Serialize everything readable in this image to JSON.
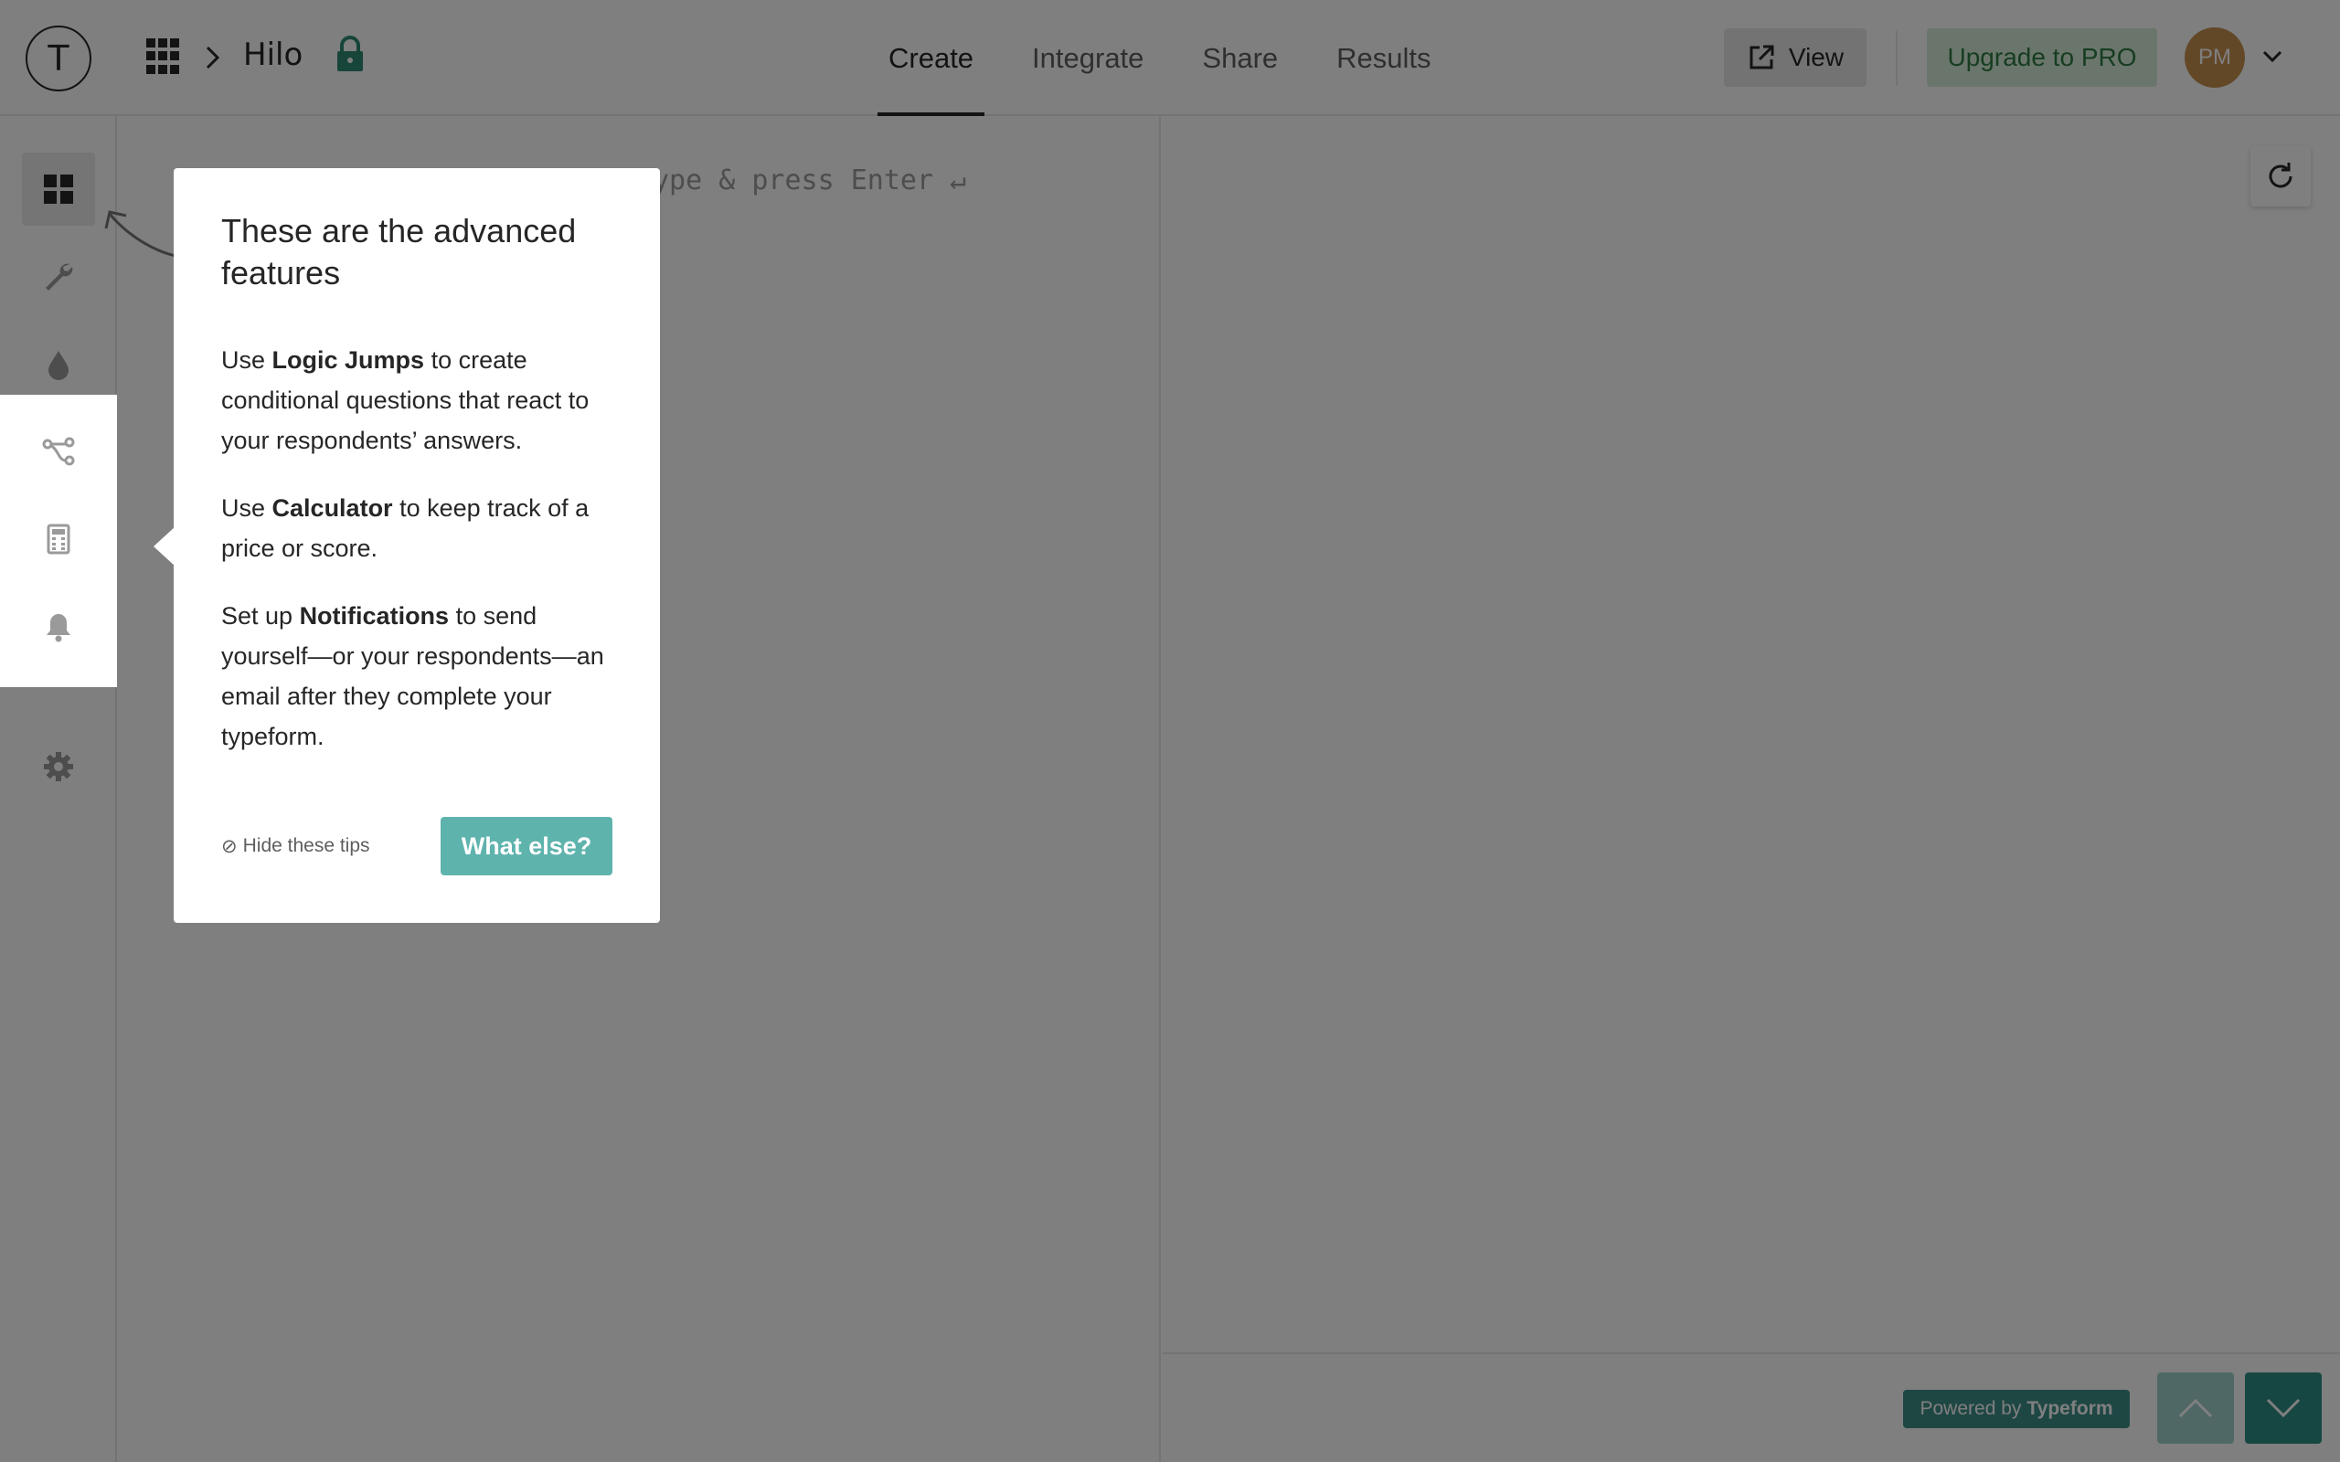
{
  "header": {
    "logo_letter": "T",
    "form_name": "Hilo",
    "tabs": [
      {
        "label": "Create",
        "active": true
      },
      {
        "label": "Integrate",
        "active": false
      },
      {
        "label": "Share",
        "active": false
      },
      {
        "label": "Results",
        "active": false
      }
    ],
    "view_label": "View",
    "upgrade_label": "Upgrade to PRO",
    "avatar_initials": "PM"
  },
  "sidebar": {
    "items": [
      {
        "icon": "grid-icon",
        "name": "content"
      },
      {
        "icon": "wrench-icon",
        "name": "settings-tools"
      },
      {
        "icon": "drop-icon",
        "name": "design"
      },
      {
        "icon": "logic-jumps-icon",
        "name": "logic-jumps"
      },
      {
        "icon": "calculator-icon",
        "name": "calculator"
      },
      {
        "icon": "bell-icon",
        "name": "notifications"
      },
      {
        "icon": "gear-icon",
        "name": "settings"
      }
    ]
  },
  "builder": {
    "placeholder": "ype & press Enter ↵"
  },
  "tip": {
    "title": "These are the advanced features",
    "p1_pre": "Use ",
    "p1_bold": "Logic Jumps",
    "p1_post": " to create conditional questions that react to your respondents’ answers.",
    "p2_pre": "Use ",
    "p2_bold": "Calculator",
    "p2_post": " to keep track of a price or score.",
    "p3_pre": "Set up ",
    "p3_bold": "Notifications",
    "p3_mid": " to send yourself",
    "p3_em": "—or your respondents—",
    "p3_post": "an email after they complete your typeform.",
    "hide_label": "Hide these tips",
    "hide_glyph": "⊘",
    "cta_label": "What else?"
  },
  "preview": {
    "powered_prefix": "Powered by",
    "powered_brand": "Typeform"
  },
  "colors": {
    "accent": "#5fb3ad",
    "upgrade_text": "#2e7a43",
    "avatar": "#c79051",
    "lock": "#2e8a73"
  }
}
